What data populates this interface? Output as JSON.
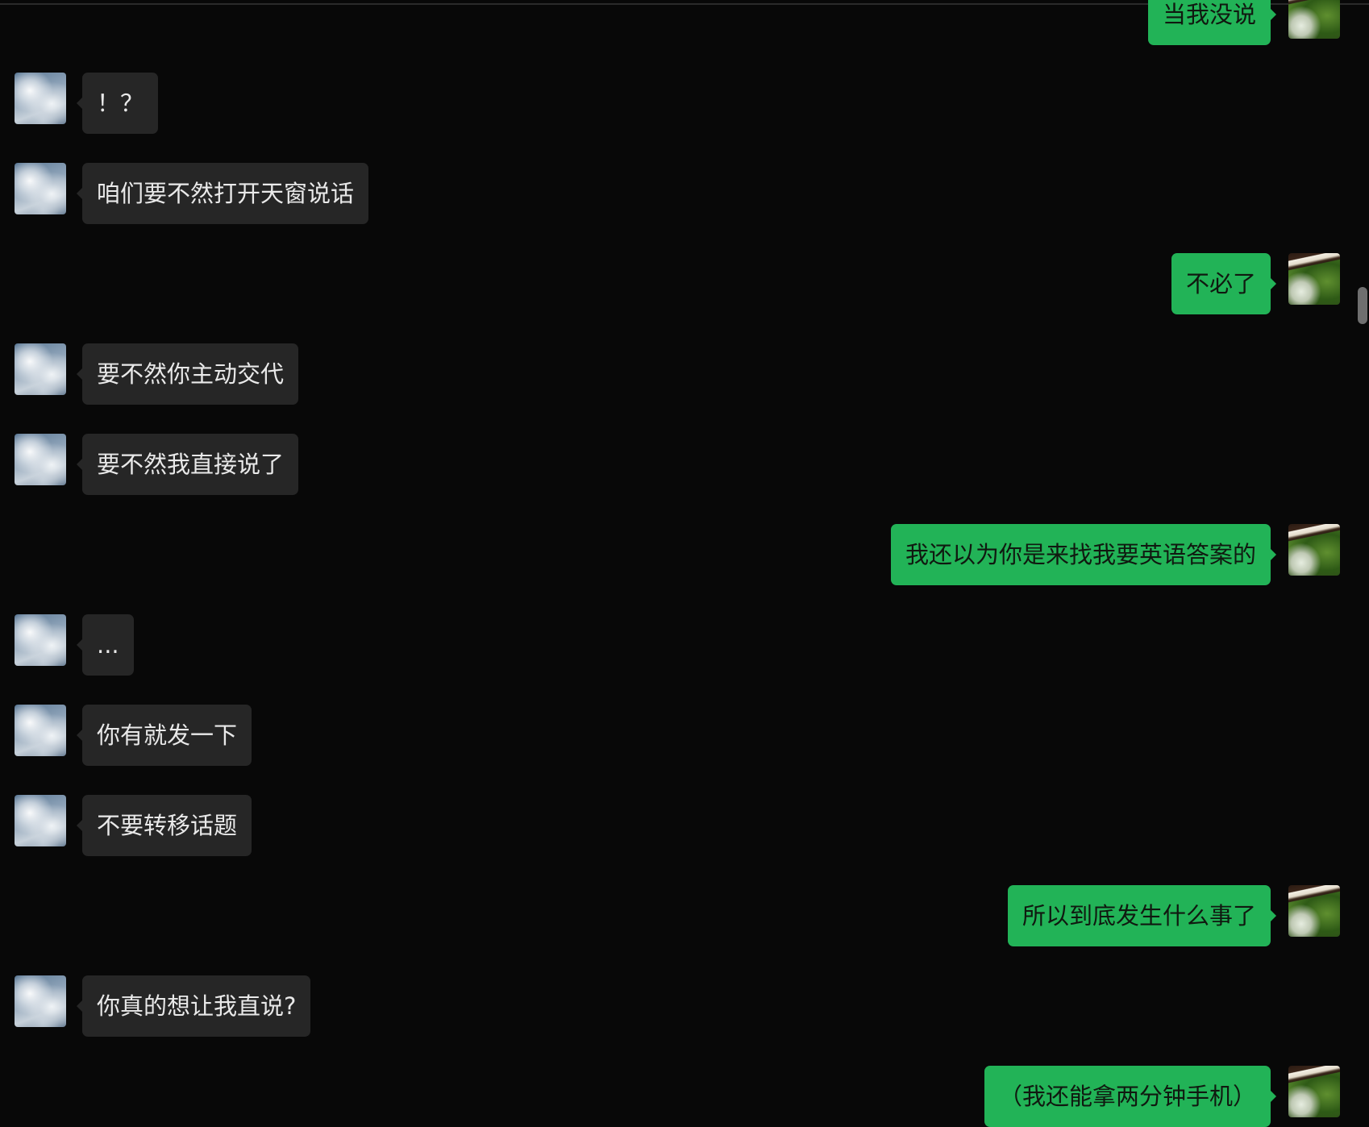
{
  "messages": [
    {
      "side": "right",
      "text": "当我没说"
    },
    {
      "side": "left",
      "text": "！？"
    },
    {
      "side": "left",
      "text": "咱们要不然打开天窗说话"
    },
    {
      "side": "right",
      "text": "不必了"
    },
    {
      "side": "left",
      "text": "要不然你主动交代"
    },
    {
      "side": "left",
      "text": "要不然我直接说了"
    },
    {
      "side": "right",
      "text": "我还以为你是来找我要英语答案的"
    },
    {
      "side": "left",
      "text": "..."
    },
    {
      "side": "left",
      "text": "你有就发一下"
    },
    {
      "side": "left",
      "text": "不要转移话题"
    },
    {
      "side": "right",
      "text": "所以到底发生什么事了"
    },
    {
      "side": "left",
      "text": "你真的想让我直说?"
    },
    {
      "side": "right",
      "text": "（我还能拿两分钟手机）"
    }
  ],
  "avatars": {
    "contact": "sky-clouds-avatar",
    "self": "grass-waterfall-avatar"
  },
  "colors": {
    "background": "#080808",
    "incoming_bubble": "#262626",
    "outgoing_bubble": "#22b357",
    "incoming_text": "#e9e9e9",
    "outgoing_text": "#101910"
  }
}
